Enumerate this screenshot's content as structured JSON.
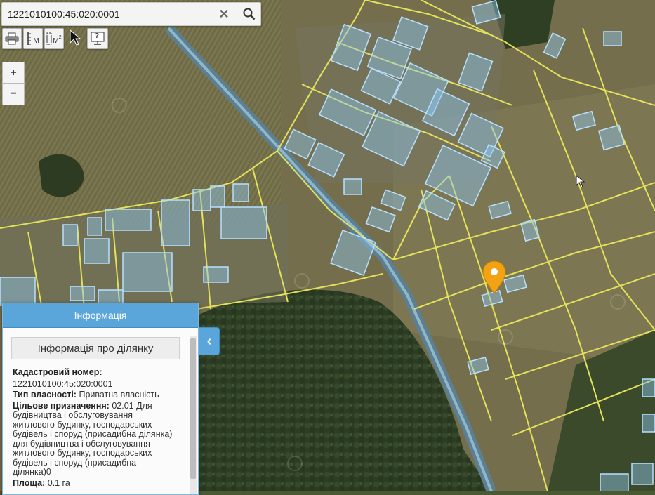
{
  "search": {
    "value": "1221010100:45:020:0001"
  },
  "toolbar": {
    "print_icon": "printer-icon",
    "measure_label": "M",
    "area_label": "M",
    "area_superscript": "2",
    "help_label": "?"
  },
  "zoom": {
    "in_label": "+",
    "out_label": "−"
  },
  "panel": {
    "title": "Інформація",
    "subtitle": "Інформація про ділянку",
    "cadastral_label": "Кадастровий номер:",
    "cadastral_value": "1221010100:45:020:0001",
    "ownership_label": "Тип власності:",
    "ownership_value": "Приватна власність",
    "purpose_label": "Цільове призначення:",
    "purpose_lines": [
      "02.01 Для",
      "будівництва і обслуговування",
      "житлового будинку, господарських",
      "будівель і споруд (присадибна ділянка)",
      "для будівництва і обслуговування",
      "житлового будинку, господарських",
      "будівель і споруд (присадибна",
      "ділянка)0"
    ],
    "area_label": "Площа:",
    "area_value": "0.1 га",
    "collapse_icon": "chevron-left-icon"
  },
  "map": {
    "marker_color": "#f2a213",
    "boundary_color": "#e4e15a",
    "parcel_color": "#8fc8f0",
    "road_color": "#6fa0bf"
  }
}
